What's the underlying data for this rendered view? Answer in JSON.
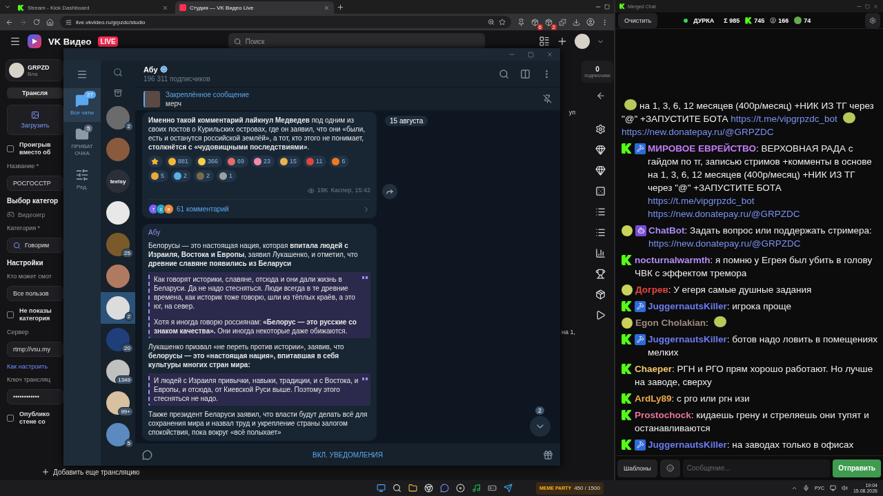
{
  "browser": {
    "tabs": [
      {
        "title": "Stream - Kick Dashboard",
        "kind": "kick",
        "selected": false
      },
      {
        "title": "Студия — VK Видео Live",
        "kind": "vk",
        "selected": true
      }
    ],
    "address": "live.vkvideo.ru/grpzdc/studio",
    "extension_badges": [
      "6",
      "2"
    ]
  },
  "vk": {
    "logo": "VK Видео",
    "live_badge": "LIVE",
    "search_placeholder": "Поиск",
    "profile": {
      "name": "GRPZD",
      "role": "Вла"
    },
    "form": [
      {
        "kind": "tab",
        "text": "Трансля"
      },
      {
        "kind": "upload",
        "text": "Загрузить"
      },
      {
        "kind": "checkbox",
        "checked": false,
        "lines": [
          "Проигрыв",
          "вместо об"
        ]
      },
      {
        "kind": "label",
        "text": "Название *"
      },
      {
        "kind": "field",
        "text": "РОСГОССТР"
      },
      {
        "kind": "heading",
        "text": "Выбор категор"
      },
      {
        "kind": "option",
        "text": "Видеоигр"
      },
      {
        "kind": "label",
        "text": "Категория *"
      },
      {
        "kind": "search",
        "text": "Говорим"
      },
      {
        "kind": "heading",
        "text": "Настройки"
      },
      {
        "kind": "label",
        "text": "Кто может смот"
      },
      {
        "kind": "field",
        "text": "Все пользов"
      },
      {
        "kind": "checkbox",
        "checked": false,
        "lines": [
          "Не показы",
          "категория"
        ]
      },
      {
        "kind": "label",
        "text": "Сервер"
      },
      {
        "kind": "field",
        "text": "rtmp://vsu.my"
      },
      {
        "kind": "link",
        "text": "Как настроить"
      },
      {
        "kind": "label",
        "text": "Ключ трансляц"
      },
      {
        "kind": "field",
        "text": "••••••••••••"
      },
      {
        "kind": "checkbox",
        "checked": false,
        "lines": [
          "Опублико",
          "стене со"
        ]
      }
    ],
    "add_stream": "Добавить еще трансляцию",
    "subscribers": {
      "count": "0",
      "label": "подписчики"
    },
    "side_fragments": [
      "уп",
      "на 1,"
    ]
  },
  "telegram": {
    "folders": [
      {
        "kind": "chats",
        "label": "Все чаты",
        "badge": "27",
        "selected": true
      },
      {
        "kind": "folder",
        "label": "ПРИВАТ ОЧКА",
        "badge": "5",
        "selected": false
      },
      {
        "kind": "edit",
        "label": "Ред.",
        "selected": false
      }
    ],
    "chats": [
      {
        "kind": "photo",
        "badge": "2",
        "selected": false
      },
      {
        "kind": "photo",
        "selected": false
      },
      {
        "kind": "text",
        "text": "teelsy",
        "selected": false
      },
      {
        "kind": "photo",
        "selected": false
      },
      {
        "kind": "photo",
        "badge": "25",
        "selected": false
      },
      {
        "kind": "photo",
        "selected": false
      },
      {
        "kind": "photo",
        "badge": "2",
        "selected": true
      },
      {
        "kind": "photo",
        "badge": "20",
        "selected": false
      },
      {
        "kind": "photo",
        "badge": "1349",
        "selected": false
      },
      {
        "kind": "photo",
        "badge": "99+",
        "selected": false
      },
      {
        "kind": "photo",
        "badge": "5",
        "selected": false
      }
    ],
    "channel": {
      "name": "Абу",
      "subscribers": "196 311 подписчиков",
      "verified": true
    },
    "pinned": {
      "title": "Закреплённое сообщение",
      "text": "мерч"
    },
    "date_chip": "15 августа",
    "post1": {
      "text": "**Именно такой комментарий лайкнул Медведев** под одним из своих постов о Курильских островах, где он заявил, что они «были, есть и останутся российской землёй», а тот, кто этого не понимает, **столкнётся с «чудовищными последствиями»**.",
      "reactions": [
        {
          "kind": "star"
        },
        {
          "kind": "emoji",
          "color": "#f5b731",
          "count": "881"
        },
        {
          "kind": "emoji",
          "color": "#f7d046",
          "count": "366"
        },
        {
          "kind": "emoji",
          "color": "#e86a6a",
          "count": "69"
        },
        {
          "kind": "emoji",
          "color": "#f28ba8",
          "count": "23"
        },
        {
          "kind": "emoji",
          "color": "#e9b44c",
          "count": "15"
        },
        {
          "kind": "emoji",
          "color": "#e0463c",
          "count": "11"
        },
        {
          "kind": "emoji",
          "color": "#f27a1a",
          "count": "6"
        },
        {
          "kind": "emoji",
          "color": "#e8a93a",
          "count": "5"
        },
        {
          "kind": "emoji",
          "color": "#5ab0e8",
          "count": "2"
        },
        {
          "kind": "emoji",
          "color": "#7a6a4a",
          "count": "2"
        },
        {
          "kind": "emoji",
          "color": "#9aa0a6",
          "count": "1"
        }
      ],
      "views": "19K",
      "signature": "Каспер, 15:42",
      "commenters": [
        {
          "letter": "т",
          "color": "#7b61ff"
        },
        {
          "letter": "с",
          "color": "#2aa8c9"
        },
        {
          "letter": "в",
          "color": "#f08a3c"
        }
      ],
      "comments": "61 комментарий"
    },
    "post2": {
      "author": "Абу",
      "blocks": [
        {
          "kind": "paragraph",
          "text": "Белорусы — это настоящая нация, которая **впитала людей с Израиля, Востока и Европы**, заявил Лукашенко, и отметил, что **древние славяне появились из Беларуси**"
        },
        {
          "kind": "quote",
          "paragraphs": [
            "Как говорят историки, славяне, отсюда и они дали жизнь в Беларуси. Да не надо стесняться. Люди всегда в те древние времена, как историк тоже говорю, шли из тёплых краёв, а это юг, на север.",
            "Хотя я иногда говорю россиянам: **«Белорус — это русские со знаком качества».** Они иногда некоторые даже обижаются."
          ]
        },
        {
          "kind": "paragraph",
          "text": "Лукашенко призвал «не переть против истории», заявив, что **белорусы — это «настоящая нация», впитавшая в себя культуры многих стран мира:**"
        },
        {
          "kind": "quote",
          "paragraphs": [
            "И людей с Израиля привычки, навыки, традиции, и с Востока, и Европы, и отсюда, от Киевской Руси выше. Поэтому этого стесняться не надо."
          ]
        },
        {
          "kind": "paragraph",
          "text": "Также президент Беларуси заявил, что власти будут делать всё для сохранения мира и назвал труд и укрепление страны залогом спокойствия, пока вокруг «всё полыхает»"
        }
      ]
    },
    "scroll_badge": "2",
    "notify_button": "ВКЛ. УВЕДОМЛЕНИЯ"
  },
  "merged_chat": {
    "title": "Merged Chat",
    "clear_button": "Очистить",
    "channel": "ДУРКА",
    "live": true,
    "stats": [
      {
        "kind": "total",
        "text": "Σ 985"
      },
      {
        "kind": "kick",
        "text": "745"
      },
      {
        "kind": "vk",
        "text": "166"
      },
      {
        "kind": "other",
        "text": "74"
      }
    ],
    "messages": [
      {
        "kind": "continuation",
        "moderator": false,
        "segments": [
          {
            "kind": "emote"
          },
          {
            "kind": "text",
            "text": "на 1, 3, 6, 12 месяцев (400р/месяц) +НИК ИЗ ТГ через \"@\" +ЗАПУСТИТЕ БОТА"
          },
          {
            "kind": "link",
            "text": "https://t.me/vipgrpzdc_bot"
          },
          {
            "kind": "emote"
          },
          {
            "kind": "link",
            "text": "https://new.donatepay.ru/@GRPZDC"
          }
        ]
      },
      {
        "kind": "kick",
        "moderator": true,
        "user": "МИРОВОЕ ЕВРЕЙСТВО",
        "color": "#c47cf5",
        "segments": [
          {
            "kind": "text",
            "text": ": ВЕРХОВНАЯ РАДА с гайдом по тг, записью стримов +комменты в основе  на 1, 3, 6, 12 месяцев (400р/месяц) +НИК ИЗ ТГ через \"@\" +ЗАПУСТИТЕ БОТА"
          },
          {
            "kind": "link",
            "text": "https://t.me/vipgrpzdc_bot"
          },
          {
            "kind": "link",
            "text": "https://new.donatepay.ru/@GRPZDC"
          }
        ]
      },
      {
        "kind": "bot",
        "moderator": false,
        "user": "ChatBot",
        "color": "#a98bf5",
        "segments": [
          {
            "kind": "text",
            "text": ": Задать вопрос или поддержать стримера:"
          },
          {
            "kind": "link",
            "text": "https://new.donatepay.ru/@GRPZDC"
          }
        ]
      },
      {
        "kind": "kick",
        "moderator": false,
        "user": "nocturnalwarmth",
        "color": "#b48cf2",
        "segments": [
          {
            "kind": "text",
            "text": ": я помню у Егрея был убить в голову ЧВК с эффектом тремора"
          }
        ]
      },
      {
        "kind": "vk",
        "moderator": false,
        "user": "Догрев",
        "color": "#e5483f",
        "segments": [
          {
            "kind": "text",
            "text": ": У егеря самые душные задания"
          }
        ]
      },
      {
        "kind": "kick",
        "moderator": true,
        "user": "JuggernautsKiller",
        "color": "#6a7cf0",
        "segments": [
          {
            "kind": "text",
            "text": ": игрока проще"
          }
        ]
      },
      {
        "kind": "vk",
        "moderator": false,
        "user": "Egon Cholakian",
        "color": "#a08a7e",
        "segments": [
          {
            "kind": "text",
            "text": ":"
          },
          {
            "kind": "emote"
          }
        ]
      },
      {
        "kind": "kick",
        "moderator": true,
        "user": "JuggernautsKiller",
        "color": "#6a7cf0",
        "segments": [
          {
            "kind": "text",
            "text": ": ботов надо ловить в помещениях  мелких"
          }
        ]
      },
      {
        "kind": "kick",
        "moderator": false,
        "user": "Chaeper",
        "color": "#f2c46e",
        "segments": [
          {
            "kind": "text",
            "text": ": РГН и РГО прям хорошо работают. Но лучше на заводе, сверху"
          }
        ]
      },
      {
        "kind": "kick",
        "moderator": false,
        "user": "ArdLy89",
        "color": "#f0a94a",
        "segments": [
          {
            "kind": "text",
            "text": ": с рго или ргн изи"
          }
        ]
      },
      {
        "kind": "kick",
        "moderator": false,
        "user": "Prostochock",
        "color": "#e8749e",
        "segments": [
          {
            "kind": "text",
            "text": ": кидаешь грену и стреляешь они тупят и останавливаются"
          }
        ]
      },
      {
        "kind": "kick",
        "moderator": true,
        "user": "JuggernautsKiller",
        "color": "#6a7cf0",
        "segments": [
          {
            "kind": "text",
            "text": ": на заводах только в офисах"
          }
        ]
      }
    ],
    "templates_button": "Шаблоны",
    "input_placeholder": "Сообщение...",
    "send_button": "Отправить"
  },
  "taskbar": {
    "widget_title": "MEME PARTY",
    "widget_progress": "450 / 1500",
    "language": "РУС",
    "time": "19:04",
    "date": "15.08.2026"
  }
}
